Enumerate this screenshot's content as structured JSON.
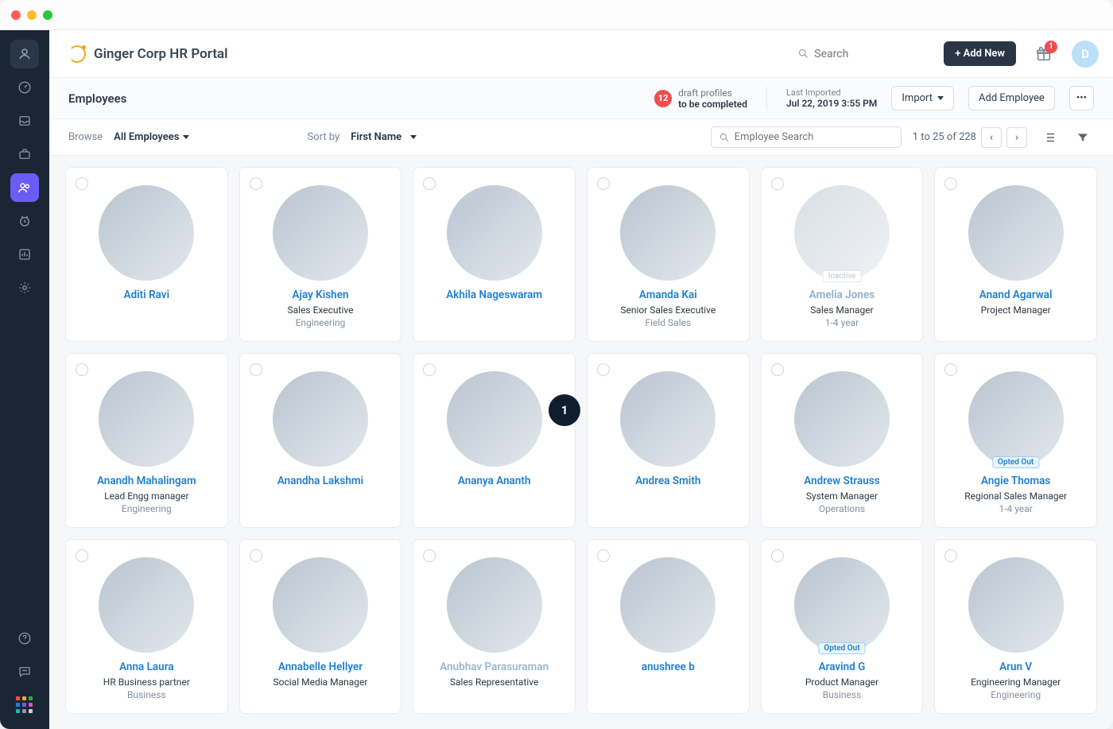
{
  "header": {
    "title": "Ginger Corp HR Portal",
    "search_placeholder": "Search",
    "add_new_label": "+ Add New",
    "gift_badge": "1",
    "avatar_letter": "D"
  },
  "subbar": {
    "title": "Employees",
    "draft_count": "12",
    "draft_line1": "draft profiles",
    "draft_line2": "to be completed",
    "imported_label": "Last Imported",
    "imported_date": "Jul 22, 2019 3:55 PM",
    "import_label": "Import",
    "add_employee_label": "Add Employee"
  },
  "filter": {
    "browse_label": "Browse",
    "browse_value": "All Employees",
    "sort_label": "Sort by",
    "sort_value": "First Name",
    "emp_search_placeholder": "Employee Search",
    "pagination": "1 to 25 of 228"
  },
  "step_badge": "1",
  "employees": [
    {
      "name": "Aditi Ravi",
      "role": "",
      "dept": "",
      "tone": "t1"
    },
    {
      "name": "Ajay Kishen",
      "role": "Sales Executive",
      "dept": "Engineering",
      "tone": "t2"
    },
    {
      "name": "Akhila Nageswaram",
      "role": "",
      "dept": "",
      "tone": "t3"
    },
    {
      "name": "Amanda Kai",
      "role": "Senior Sales Executive",
      "dept": "Field Sales",
      "tone": "t4"
    },
    {
      "name": "Amelia Jones",
      "role": "Sales Manager",
      "dept": "1-4 year",
      "tone": "t5",
      "inactive": true,
      "tag": "Inactive"
    },
    {
      "name": "Anand Agarwal",
      "role": "Project Manager",
      "dept": "",
      "tone": "t6"
    },
    {
      "name": "Anandh Mahalingam",
      "role": "Lead Engg manager",
      "dept": "Engineering",
      "tone": "t1"
    },
    {
      "name": "Anandha Lakshmi",
      "role": "",
      "dept": "",
      "tone": "t4"
    },
    {
      "name": "Ananya Ananth",
      "role": "",
      "dept": "",
      "tone": "t5"
    },
    {
      "name": "Andrea Smith",
      "role": "",
      "dept": "",
      "tone": "t2"
    },
    {
      "name": "Andrew Strauss",
      "role": "System Manager",
      "dept": "Operations",
      "tone": "t4"
    },
    {
      "name": "Angie Thomas",
      "role": "Regional Sales Manager",
      "dept": "1-4 year",
      "tone": "t6",
      "tag": "Opted Out",
      "tagOpt": true
    },
    {
      "name": "Anna Laura",
      "role": "HR Business partner",
      "dept": "Business",
      "tone": "t4"
    },
    {
      "name": "Annabelle Hellyer",
      "role": "Social Media Manager",
      "dept": "",
      "tone": "t5"
    },
    {
      "name": "Anubhav Parasuraman",
      "role": "Sales Representative",
      "dept": "",
      "tone": "t2",
      "muted": true
    },
    {
      "name": "anushree b",
      "role": "",
      "dept": "",
      "tone": "t4"
    },
    {
      "name": "Aravind G",
      "role": "Product Manager",
      "dept": "Business",
      "tone": "t1",
      "tag": "Opted Out",
      "tagOpt": true
    },
    {
      "name": "Arun V",
      "role": "Engineering Manager",
      "dept": "Engineering",
      "tone": "t6"
    }
  ]
}
